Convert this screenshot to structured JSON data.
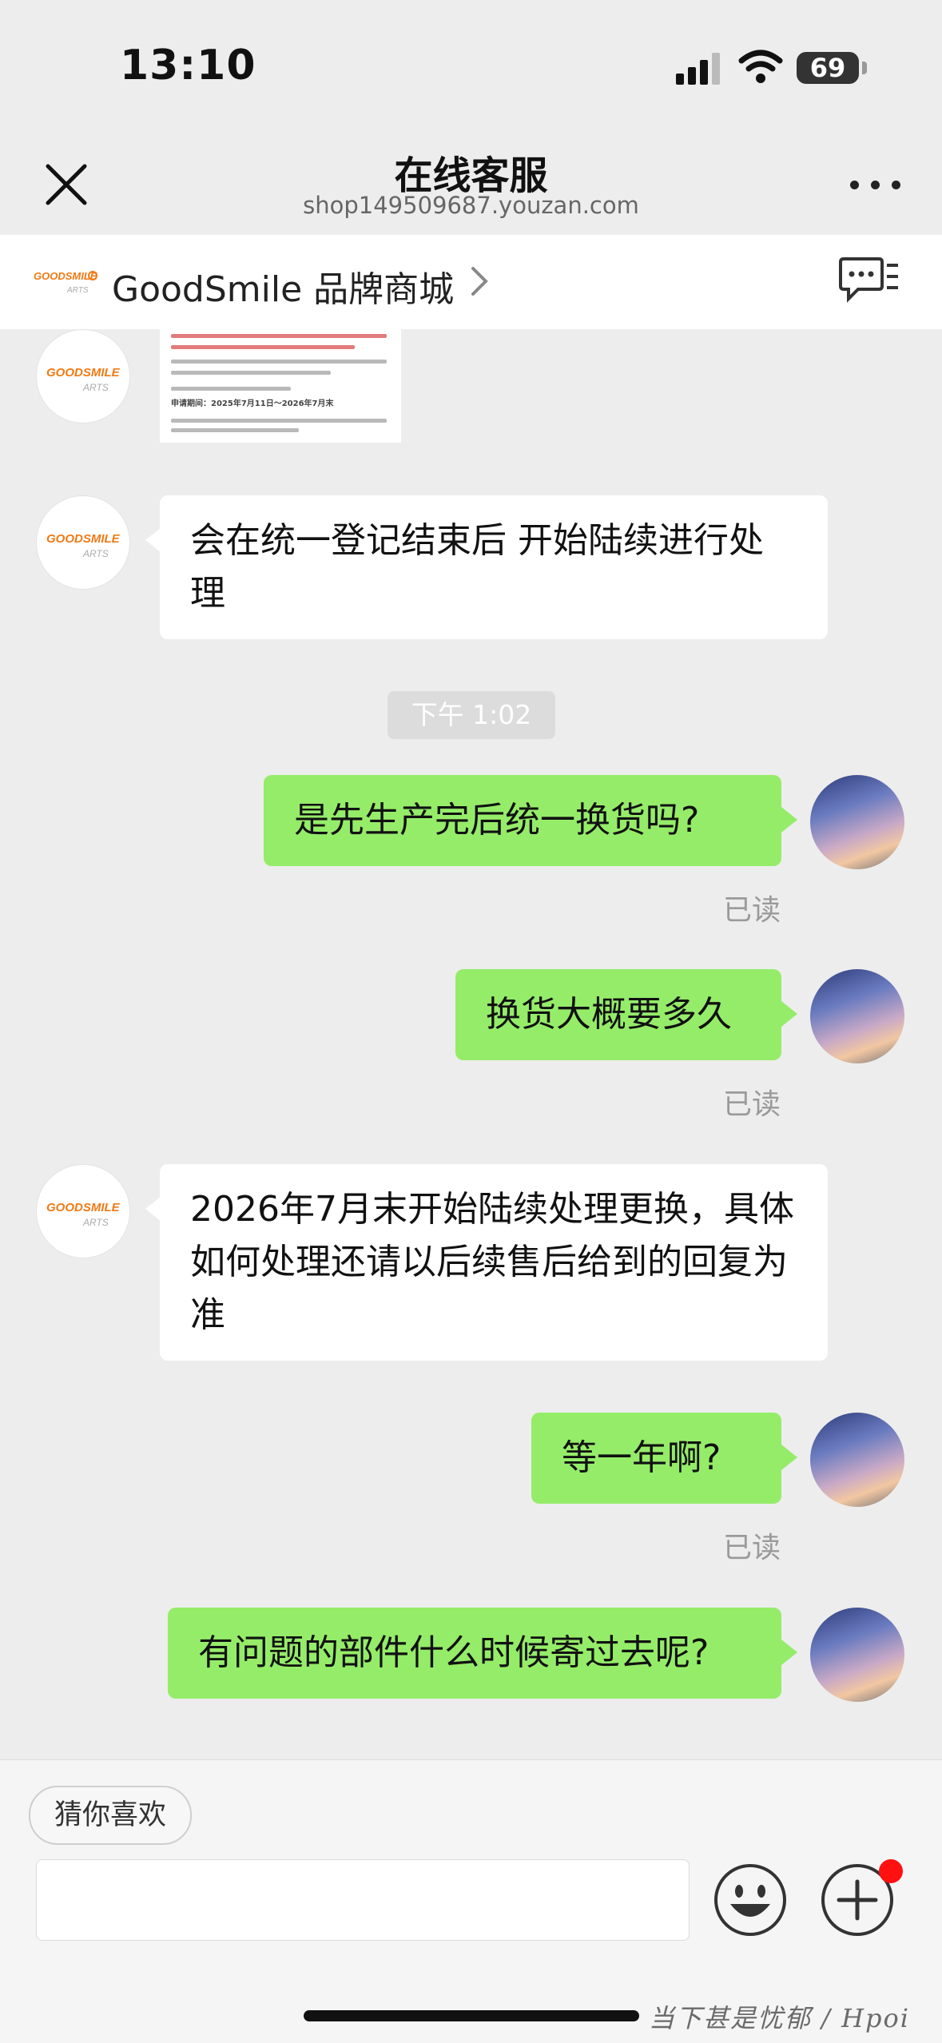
{
  "status_bar": {
    "time": "13:10",
    "battery": "69"
  },
  "header": {
    "title": "在线客服",
    "subtitle": "shop149509687.youzan.com"
  },
  "shop": {
    "name": "GoodSmile 品牌商城",
    "logo_text": "GOODSMILE",
    "logo_subtext": "ARTS"
  },
  "messages": [
    {
      "side": "in",
      "type": "image",
      "text_lines": [
        "申请期间：2025年7月11日～2026年7月末"
      ]
    },
    {
      "side": "in",
      "type": "text",
      "text": "会在统一登记结束后 开始陆续进行处理"
    },
    {
      "type": "time",
      "text": "下午 1:02"
    },
    {
      "side": "out",
      "type": "text",
      "text": "是先生产完后统一换货吗?",
      "status": "已读"
    },
    {
      "side": "out",
      "type": "text",
      "text": "换货大概要多久",
      "status": "已读"
    },
    {
      "side": "in",
      "type": "text",
      "text": "2026年7月末开始陆续处理更换，具体如何处理还请以后续售后给到的回复为准"
    },
    {
      "side": "out",
      "type": "text",
      "text": "等一年啊?",
      "status": "已读"
    },
    {
      "side": "out",
      "type": "text",
      "text": "有问题的部件什么时候寄过去呢?"
    }
  ],
  "bottom": {
    "suggestion_chip": "猜你喜欢",
    "input_placeholder": "",
    "watermark": "当下甚是忧郁 / Hpoi"
  },
  "colors": {
    "bubble_out": "#95ec69",
    "bubble_in": "#ffffff",
    "background": "#ededed",
    "badge": "#ff1111"
  }
}
